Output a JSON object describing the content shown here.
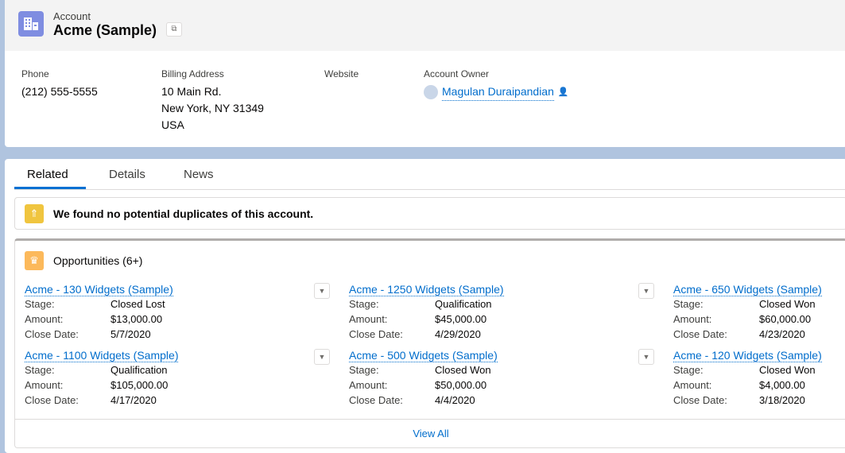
{
  "header": {
    "object_type": "Account",
    "name": "Acme (Sample)"
  },
  "fields": [
    {
      "label": "Phone",
      "lines": [
        "(212) 555-5555"
      ]
    },
    {
      "label": "Billing Address",
      "lines": [
        "10 Main Rd.",
        "New York, NY 31349",
        "USA"
      ]
    },
    {
      "label": "Website",
      "lines": []
    },
    {
      "label": "Account Owner",
      "value": "Magulan Duraipandian"
    }
  ],
  "tabs": [
    "Related",
    "Details",
    "News"
  ],
  "duplicates": {
    "message": "We found no potential duplicates of this account."
  },
  "opportunities": {
    "title": "Opportunities (6+)",
    "labels": {
      "stage": "Stage:",
      "amount": "Amount:",
      "close": "Close Date:"
    },
    "items": [
      {
        "name": "Acme - 130 Widgets (Sample)",
        "stage": "Closed Lost",
        "amount": "$13,000.00",
        "close": "5/7/2020"
      },
      {
        "name": "Acme - 1250 Widgets (Sample)",
        "stage": "Qualification",
        "amount": "$45,000.00",
        "close": "4/29/2020"
      },
      {
        "name": "Acme - 650 Widgets (Sample)",
        "stage": "Closed Won",
        "amount": "$60,000.00",
        "close": "4/23/2020"
      },
      {
        "name": "Acme - 1100 Widgets (Sample)",
        "stage": "Qualification",
        "amount": "$105,000.00",
        "close": "4/17/2020"
      },
      {
        "name": "Acme - 500 Widgets (Sample)",
        "stage": "Closed Won",
        "amount": "$50,000.00",
        "close": "4/4/2020"
      },
      {
        "name": "Acme - 120 Widgets (Sample)",
        "stage": "Closed Won",
        "amount": "$4,000.00",
        "close": "3/18/2020"
      }
    ],
    "view_all": "View All"
  }
}
